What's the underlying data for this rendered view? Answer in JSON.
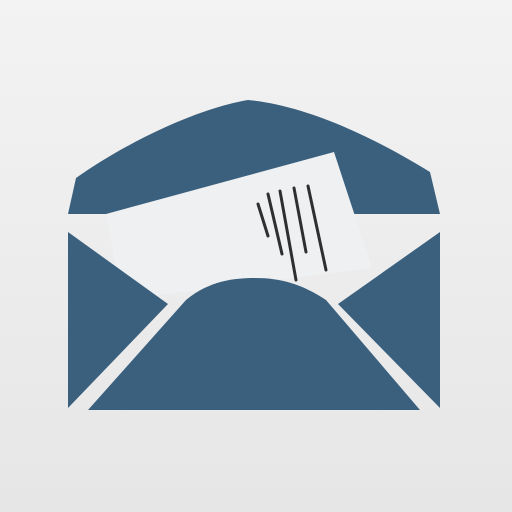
{
  "icon": {
    "name": "open-envelope-with-letter-icon",
    "colors": {
      "background_top": "#f3f3f3",
      "background_bottom": "#e6e6e6",
      "envelope": "#3b607e",
      "paper": "#eef0f1",
      "ink": "#2f2f2f",
      "gap": "#e9e9e9"
    }
  }
}
